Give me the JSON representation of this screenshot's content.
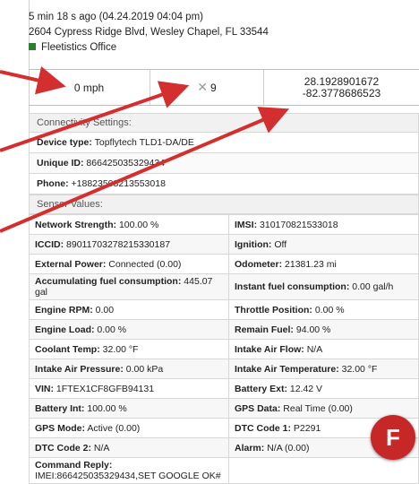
{
  "header": {
    "time_line": "5 min 18 s ago (04.24.2019 04:04 pm)",
    "address": "2604 Cypress Ridge Blvd, Wesley Chapel, FL 33544",
    "office": "Fleetistics Office",
    "office_color": "#2e7d32"
  },
  "stats": {
    "speed": "0 mph",
    "satellites": "9",
    "lat": "28.1928901672",
    "lon": "-82.3778686523"
  },
  "connectivity": {
    "title": "Connectivity Settings:",
    "device_type_label": "Device type:",
    "device_type_value": "Topflytech TLD1-DA/DE",
    "unique_id_label": "Unique ID:",
    "unique_id_value": "866425035329434",
    "phone_label": "Phone:",
    "phone_value": "+18823508213553018"
  },
  "sensors": {
    "title": "Sensor Values:",
    "rows": [
      [
        "Network Strength:",
        "100.00 %",
        "IMSI:",
        "310170821533018"
      ],
      [
        "ICCID:",
        "89011703278215330187",
        "Ignition:",
        "Off"
      ],
      [
        "External Power:",
        "Connected (0.00)",
        "Odometer:",
        "21381.23 mi"
      ],
      [
        "Accumulating fuel consumption:",
        "445.07 gal",
        "Instant fuel consumption:",
        "0.00 gal/h"
      ],
      [
        "Engine RPM:",
        "0.00",
        "Throttle Position:",
        "0.00 %"
      ],
      [
        "Engine Load:",
        "0.00 %",
        "Remain Fuel:",
        "94.00 %"
      ],
      [
        "Coolant Temp:",
        "32.00 °F",
        "Intake Air Flow:",
        "N/A"
      ],
      [
        "Intake Air Pressure:",
        "0.00 kPa",
        "Intake Air Temperature:",
        "32.00 °F"
      ],
      [
        "VIN:",
        "1FTEX1CF8GFB94131",
        "Battery Ext:",
        "12.42 V"
      ],
      [
        "Battery Int:",
        "100.00 %",
        "GPS Data:",
        "Real Time (0.00)"
      ],
      [
        "GPS Mode:",
        "Active (0.00)",
        "DTC Code 1:",
        "P2291"
      ],
      [
        "DTC Code 2:",
        "N/A",
        "Alarm:",
        "N/A (0.00)"
      ],
      [
        "Command Reply:",
        "IMEI:866425035329434,SET GOOGLE OK#",
        "",
        ""
      ]
    ]
  },
  "badge": {
    "letter": "F",
    "color": "#c62828"
  },
  "arrow_color": "#d32f2f"
}
